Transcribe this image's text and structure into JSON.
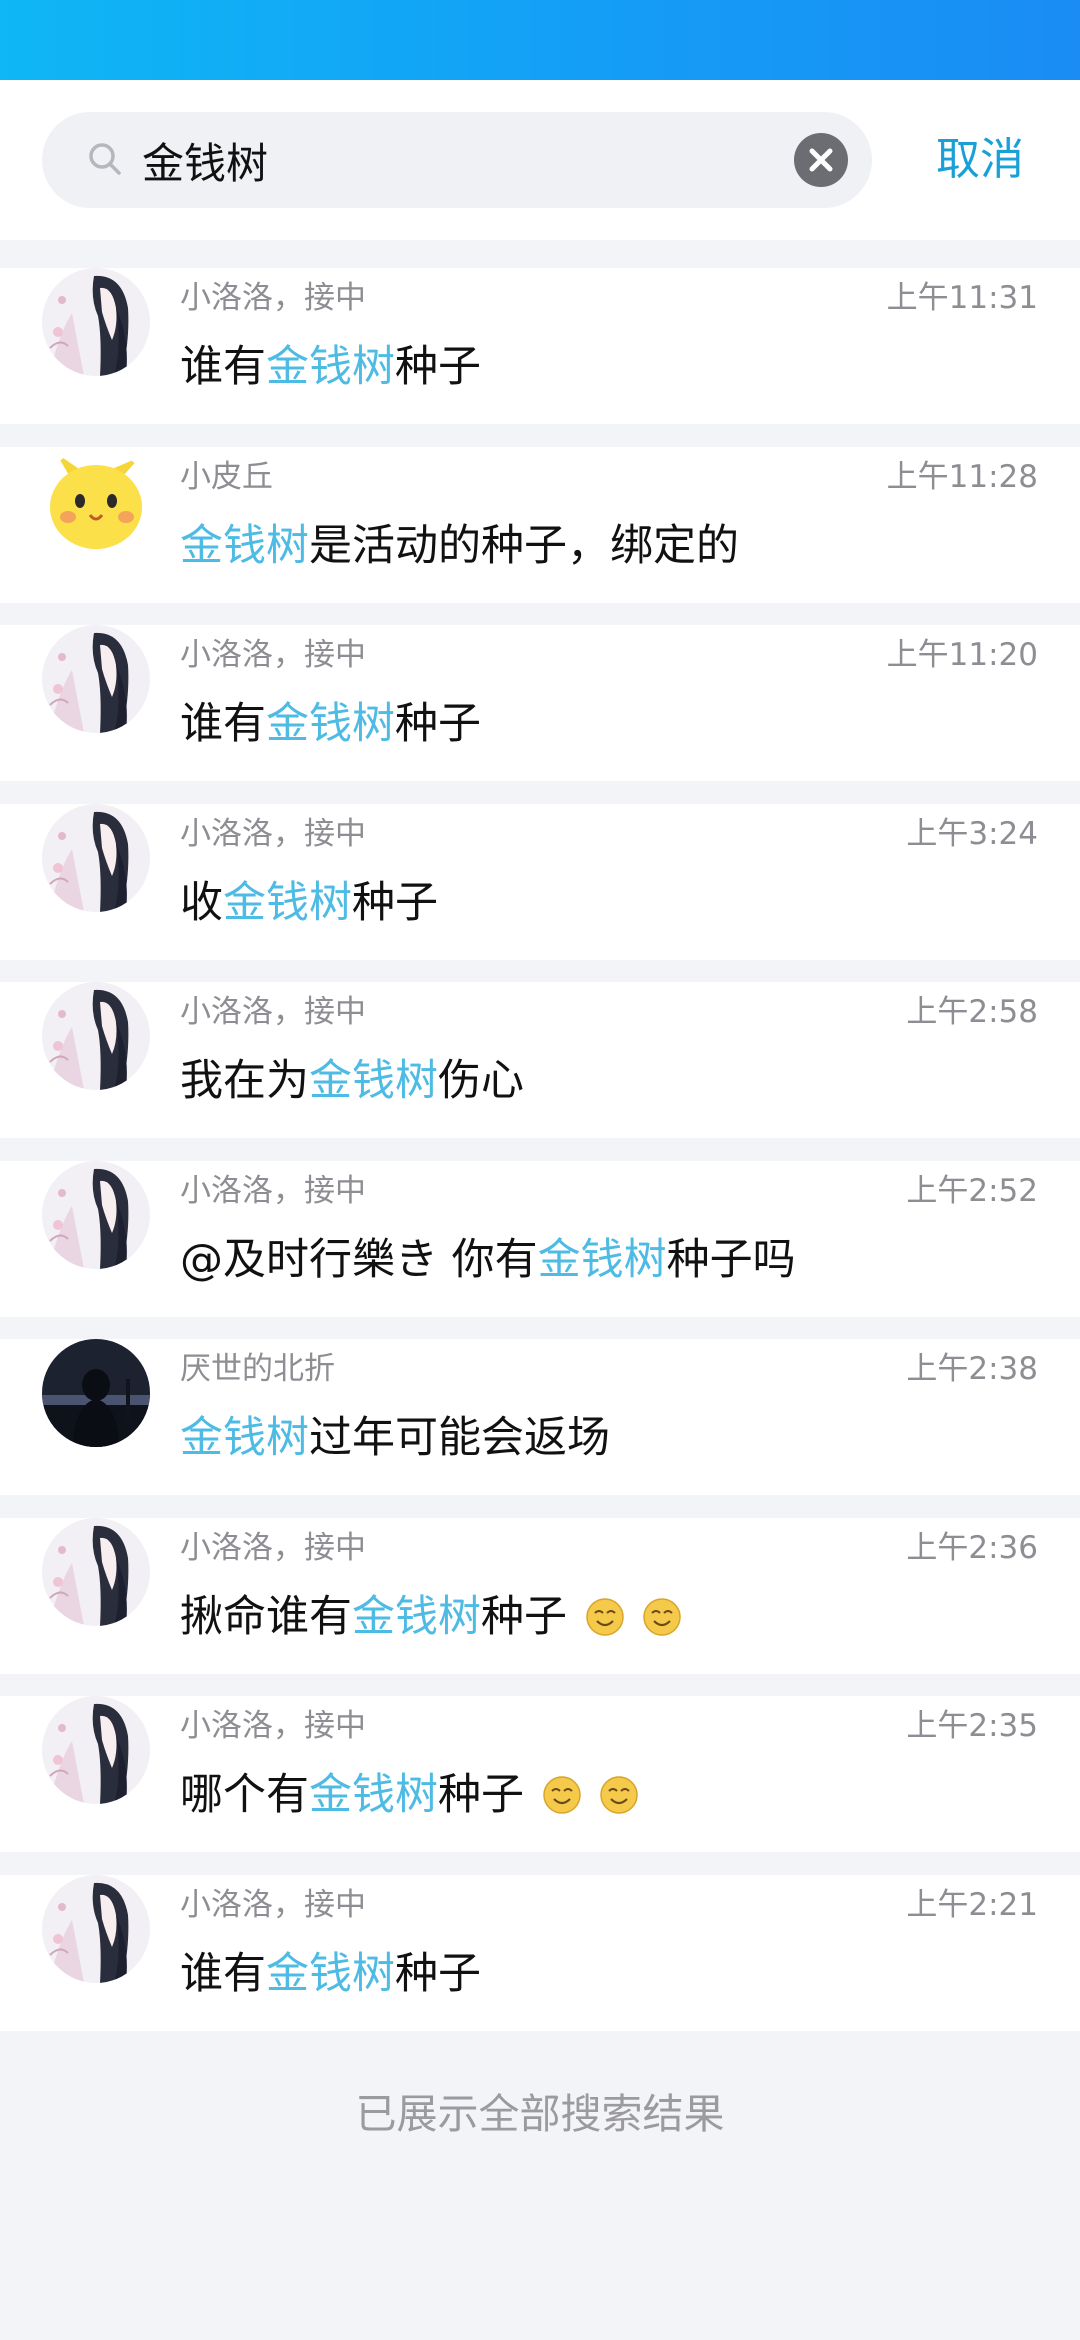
{
  "search": {
    "value": "金钱树",
    "cancel_label": "取消"
  },
  "colors": {
    "header_gradient_start": "#0fb7f5",
    "header_gradient_end": "#1a8cf4",
    "highlight": "#4dbbe4",
    "cancel": "#1aa0d8"
  },
  "results": [
    {
      "sender": "小洛洛，接中",
      "time": "上午11:31",
      "avatar": "anime-girl-avatar",
      "pre": "谁有",
      "match": "金钱树",
      "post": "种子",
      "emoji_count": 0
    },
    {
      "sender": "小皮丘",
      "time": "上午11:28",
      "avatar": "pichu-avatar",
      "pre": "",
      "match": "金钱树",
      "post": "是活动的种子，绑定的",
      "emoji_count": 0
    },
    {
      "sender": "小洛洛，接中",
      "time": "上午11:20",
      "avatar": "anime-girl-avatar",
      "pre": "谁有",
      "match": "金钱树",
      "post": "种子",
      "emoji_count": 0
    },
    {
      "sender": "小洛洛，接中",
      "time": "上午3:24",
      "avatar": "anime-girl-avatar",
      "pre": "收",
      "match": "金钱树",
      "post": "种子",
      "emoji_count": 0
    },
    {
      "sender": "小洛洛，接中",
      "time": "上午2:58",
      "avatar": "anime-girl-avatar",
      "pre": "我在为",
      "match": "金钱树",
      "post": "伤心",
      "emoji_count": 0
    },
    {
      "sender": "小洛洛，接中",
      "time": "上午2:52",
      "avatar": "anime-girl-avatar",
      "pre": "@及时行樂き 你有",
      "match": "金钱树",
      "post": "种子吗",
      "emoji_count": 0
    },
    {
      "sender": "厌世的北折",
      "time": "上午2:38",
      "avatar": "dark-silhouette-avatar",
      "pre": "",
      "match": "金钱树",
      "post": "过年可能会返场",
      "emoji_count": 0
    },
    {
      "sender": "小洛洛，接中",
      "time": "上午2:36",
      "avatar": "anime-girl-avatar",
      "pre": "揪命谁有",
      "match": "金钱树",
      "post": "种子",
      "emoji_count": 2
    },
    {
      "sender": "小洛洛，接中",
      "time": "上午2:35",
      "avatar": "anime-girl-avatar",
      "pre": "哪个有",
      "match": "金钱树",
      "post": "种子",
      "emoji_count": 2
    },
    {
      "sender": "小洛洛，接中",
      "time": "上午2:21",
      "avatar": "anime-girl-avatar",
      "pre": "谁有",
      "match": "金钱树",
      "post": "种子",
      "emoji_count": 0
    }
  ],
  "footer": {
    "text": "已展示全部搜索结果"
  }
}
